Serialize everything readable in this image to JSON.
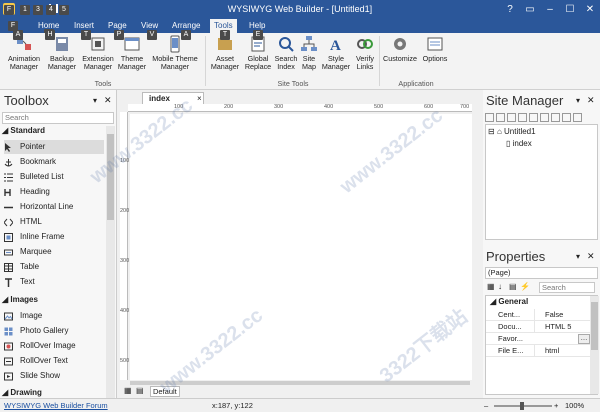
{
  "window": {
    "title": "WYSIWYG Web Builder - [Untitled1]",
    "keytips_qat": [
      "F",
      "1",
      "3",
      "4",
      "5"
    ]
  },
  "tabs": [
    {
      "label": "Home",
      "keytip": "H"
    },
    {
      "label": "Insert",
      "keytip": ""
    },
    {
      "label": "Page",
      "keytip": ""
    },
    {
      "label": "View",
      "keytip": ""
    },
    {
      "label": "Arrange",
      "keytip": ""
    },
    {
      "label": "Tools",
      "keytip": ""
    },
    {
      "label": "Help",
      "keytip": ""
    }
  ],
  "file_keytip": "F",
  "ribbon": {
    "groups": [
      {
        "label": "Tools"
      },
      {
        "label": "Site Tools"
      },
      {
        "label": "Application"
      }
    ],
    "buttons": [
      {
        "label": "Animation Manager",
        "keytip": "A"
      },
      {
        "label": "Backup Manager",
        "keytip": "H"
      },
      {
        "label": "Extension Manager",
        "keytip": "T"
      },
      {
        "label": "Theme Manager",
        "keytip": "P"
      },
      {
        "label": "Mobile Theme Manager",
        "keytip": "V"
      },
      {
        "label": "Asset Manager",
        "keytip": "T"
      },
      {
        "label": "Global Replace",
        "keytip": "E"
      },
      {
        "label": "Search Index",
        "keytip": ""
      },
      {
        "label": "Site Map",
        "keytip": ""
      },
      {
        "label": "Style Manager",
        "keytip": ""
      },
      {
        "label": "Verify Links",
        "keytip": ""
      },
      {
        "label": "Customize",
        "keytip": ""
      },
      {
        "label": "Options",
        "keytip": ""
      }
    ]
  },
  "toolbox": {
    "title": "Toolbox",
    "search_placeholder": "Search",
    "sections": [
      {
        "label": "Standard",
        "items": [
          "Pointer",
          "Bookmark",
          "Bulleted List",
          "Heading",
          "Horizontal Line",
          "HTML",
          "Inline Frame",
          "Marquee",
          "Table",
          "Text"
        ]
      },
      {
        "label": "Images",
        "items": [
          "Image",
          "Photo Gallery",
          "RollOver Image",
          "RollOver Text",
          "Slide Show"
        ]
      },
      {
        "label": "Drawing",
        "items": []
      }
    ]
  },
  "editor": {
    "doc_tab": "index",
    "doc_tab_close": "×",
    "bottom_tab": "Default",
    "ruler_top": [
      "100",
      "200",
      "300",
      "400",
      "500",
      "600",
      "700"
    ],
    "ruler_left": [
      "100",
      "200",
      "300",
      "400",
      "500",
      "600"
    ]
  },
  "site_manager": {
    "title": "Site Manager",
    "tree": [
      {
        "label": "Untitled1"
      },
      {
        "label": "index"
      }
    ]
  },
  "properties": {
    "title": "Properties",
    "object": "(Page)",
    "search_placeholder": "Search",
    "category": "General",
    "rows": [
      {
        "name": "Centered",
        "display": "Cent...",
        "value": "False"
      },
      {
        "name": "Document Type",
        "display": "Docu...",
        "value": "HTML 5"
      },
      {
        "name": "Favorite Icon",
        "display": "Favor...",
        "value": ""
      },
      {
        "name": "File Extension",
        "display": "File E...",
        "value": "html"
      }
    ]
  },
  "status": {
    "forum_link": "WYSIWYG Web Builder Forum",
    "coords": "x:187, y:122",
    "zoom": "100%"
  },
  "watermark_text": "3322下载站",
  "watermark_url": "www.3322.cc",
  "colors": {
    "title_bar": "#2b579a",
    "ribbon": "#f3f3f3",
    "accent": "#2b579a"
  }
}
